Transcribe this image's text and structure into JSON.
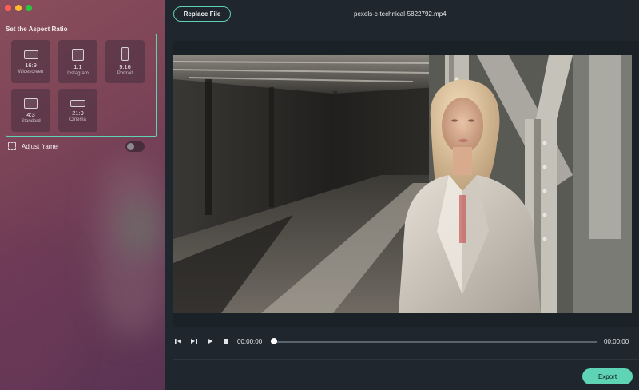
{
  "window": {
    "file_name": "pexels-c-technical-5822792.mp4"
  },
  "aspect_panel": {
    "heading": "Set the Aspect Ratio",
    "ratios": [
      {
        "ratio": "16:9",
        "name": "Widescreen"
      },
      {
        "ratio": "1:1",
        "name": "Instagram"
      },
      {
        "ratio": "9:16",
        "name": "Portrait"
      },
      {
        "ratio": "4:3",
        "name": "Standard"
      },
      {
        "ratio": "21:9",
        "name": "Cinema"
      }
    ],
    "selected_ratio": "16:9",
    "adjust_frame_label": "Adjust frame",
    "adjust_frame_enabled": false
  },
  "toolbar": {
    "replace_label": "Replace File"
  },
  "player": {
    "current_time": "00:00:00",
    "total_time": "00:00:00",
    "progress": 0,
    "icons": [
      "previous-frame-icon",
      "next-frame-icon",
      "play-icon",
      "stop-icon"
    ]
  },
  "footer": {
    "export_label": "Export"
  },
  "colors": {
    "accent": "#5fd3b5",
    "window_close": "#ff5f57",
    "window_minimize": "#febc2e",
    "window_zoom": "#28c840",
    "background": "#1f262d"
  }
}
